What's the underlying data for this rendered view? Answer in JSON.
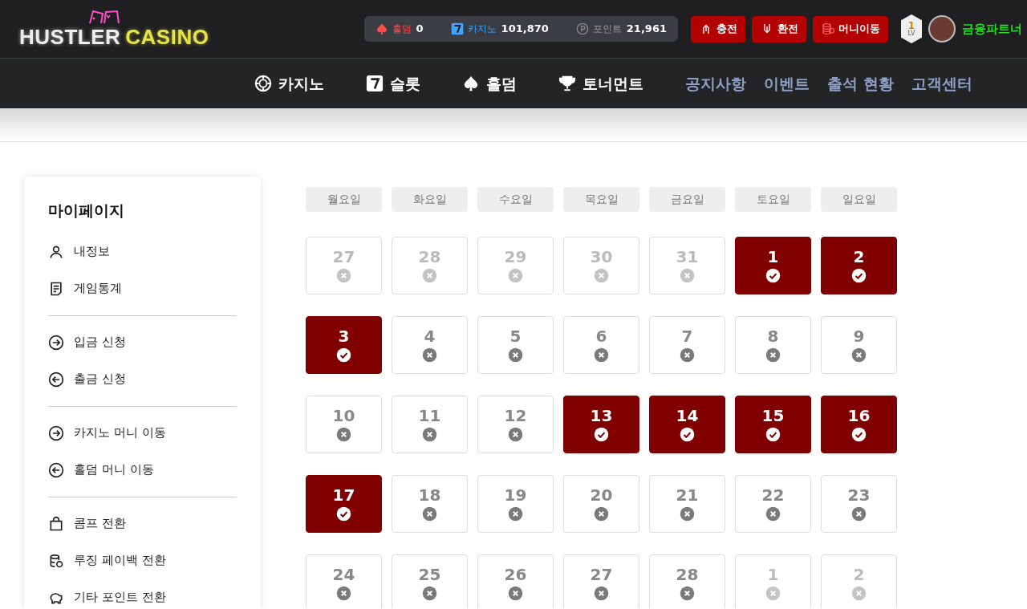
{
  "logo": {
    "word_1": "HUSTLER",
    "word_2": "CASINO"
  },
  "balances": [
    {
      "kind": "holdem",
      "label": "홀덤",
      "value": "0"
    },
    {
      "kind": "casino",
      "label": "카지노",
      "value": "101,870"
    },
    {
      "kind": "point",
      "label": "포인트",
      "value": "21,961"
    }
  ],
  "actions": [
    {
      "kind": "deposit",
      "label": "충전"
    },
    {
      "kind": "withdraw",
      "label": "환전"
    },
    {
      "kind": "transfer",
      "label": "머니이동"
    }
  ],
  "rank_badge": {
    "number": "1",
    "caption": "LV"
  },
  "user": {
    "name": "금융파트너"
  },
  "nav": [
    {
      "kind": "casino",
      "label": "카지노"
    },
    {
      "kind": "slots",
      "label": "슬롯"
    },
    {
      "kind": "holdem",
      "label": "홀덤"
    },
    {
      "kind": "tournament",
      "label": "토너먼트"
    },
    {
      "kind": "link",
      "label": "공지사항"
    },
    {
      "kind": "link",
      "label": "이벤트"
    },
    {
      "kind": "link",
      "label": "출석 현황"
    },
    {
      "kind": "link",
      "label": "고객센터"
    }
  ],
  "sidebar": {
    "title": "마이페이지",
    "groups": [
      [
        {
          "kind": "profile",
          "label": "내정보"
        },
        {
          "kind": "stats",
          "label": "게임통계"
        }
      ],
      [
        {
          "kind": "deposit",
          "label": "입금 신청"
        },
        {
          "kind": "withdraw",
          "label": "출금 신청"
        }
      ],
      [
        {
          "kind": "move-in",
          "label": "카지노 머니 이동"
        },
        {
          "kind": "move-out",
          "label": "홀덤 머니 이동"
        }
      ],
      [
        {
          "kind": "comp",
          "label": "콤프 전환"
        },
        {
          "kind": "payback",
          "label": "루징 페이백 전환"
        },
        {
          "kind": "points",
          "label": "기타 포인트 전환"
        }
      ]
    ]
  },
  "calendar": {
    "weekdays": [
      "월요일",
      "화요일",
      "수요일",
      "목요일",
      "금요일",
      "토요일",
      "일요일"
    ],
    "days": [
      {
        "day": "27",
        "outside": true,
        "attended": false
      },
      {
        "day": "28",
        "outside": true,
        "attended": false
      },
      {
        "day": "29",
        "outside": true,
        "attended": false
      },
      {
        "day": "30",
        "outside": true,
        "attended": false
      },
      {
        "day": "31",
        "outside": true,
        "attended": false
      },
      {
        "day": "1",
        "outside": false,
        "attended": true
      },
      {
        "day": "2",
        "outside": false,
        "attended": true
      },
      {
        "day": "3",
        "outside": false,
        "attended": true
      },
      {
        "day": "4",
        "outside": false,
        "attended": false
      },
      {
        "day": "5",
        "outside": false,
        "attended": false
      },
      {
        "day": "6",
        "outside": false,
        "attended": false
      },
      {
        "day": "7",
        "outside": false,
        "attended": false
      },
      {
        "day": "8",
        "outside": false,
        "attended": false
      },
      {
        "day": "9",
        "outside": false,
        "attended": false
      },
      {
        "day": "10",
        "outside": false,
        "attended": false
      },
      {
        "day": "11",
        "outside": false,
        "attended": false
      },
      {
        "day": "12",
        "outside": false,
        "attended": false
      },
      {
        "day": "13",
        "outside": false,
        "attended": true
      },
      {
        "day": "14",
        "outside": false,
        "attended": true
      },
      {
        "day": "15",
        "outside": false,
        "attended": true
      },
      {
        "day": "16",
        "outside": false,
        "attended": true
      },
      {
        "day": "17",
        "outside": false,
        "attended": true
      },
      {
        "day": "18",
        "outside": false,
        "attended": false
      },
      {
        "day": "19",
        "outside": false,
        "attended": false
      },
      {
        "day": "20",
        "outside": false,
        "attended": false
      },
      {
        "day": "21",
        "outside": false,
        "attended": false
      },
      {
        "day": "22",
        "outside": false,
        "attended": false
      },
      {
        "day": "23",
        "outside": false,
        "attended": false
      },
      {
        "day": "24",
        "outside": false,
        "attended": false
      },
      {
        "day": "25",
        "outside": false,
        "attended": false
      },
      {
        "day": "26",
        "outside": false,
        "attended": false
      },
      {
        "day": "27",
        "outside": false,
        "attended": false
      },
      {
        "day": "28",
        "outside": false,
        "attended": false
      },
      {
        "day": "1",
        "outside": true,
        "attended": false
      },
      {
        "day": "2",
        "outside": true,
        "attended": false
      }
    ]
  }
}
